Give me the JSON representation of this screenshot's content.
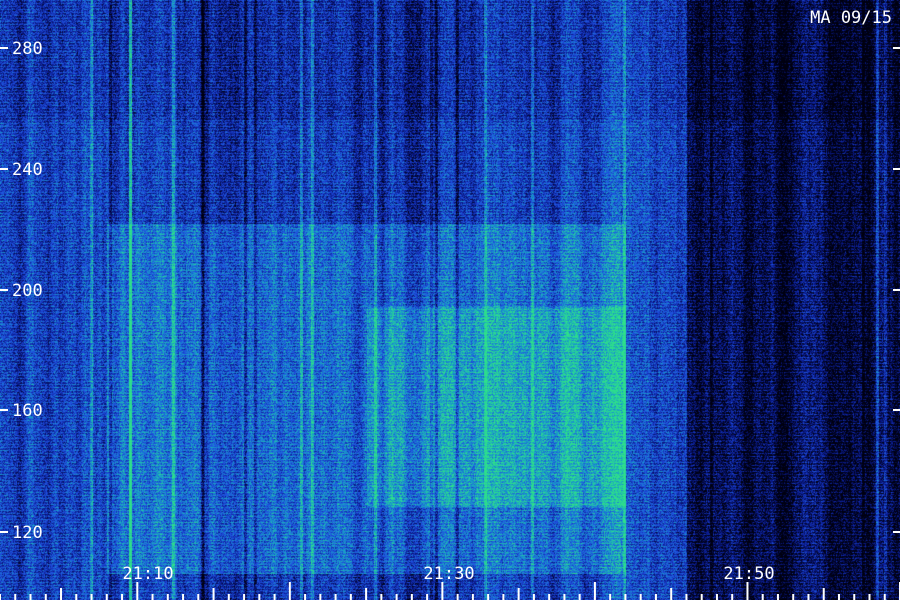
{
  "chart_data": {
    "type": "heatmap",
    "title": "MA 09/15",
    "xlabel": "",
    "ylabel": "",
    "y_ticks": [
      "280",
      "240",
      "200",
      "160",
      "120"
    ],
    "y_range": [
      112,
      292
    ],
    "x_ticks": [
      "21:10",
      "21:30",
      "21:50"
    ],
    "x_range_minutes_after_2100": [
      1,
      60
    ],
    "grid": false,
    "colormap": [
      "#000010",
      "#0a1a8c",
      "#1f4fe0",
      "#19a0c8",
      "#2ee08a"
    ],
    "intensity_regions": [
      {
        "label": "high",
        "x_from": "21:08",
        "x_to": "21:42",
        "y_from": 120,
        "y_to": 225
      },
      {
        "label": "high",
        "x_from": "21:25",
        "x_to": "21:42",
        "y_from": 140,
        "y_to": 200
      },
      {
        "label": "low",
        "x_from": "21:46",
        "x_to": "22:00",
        "y_from": 112,
        "y_to": 292
      }
    ]
  }
}
